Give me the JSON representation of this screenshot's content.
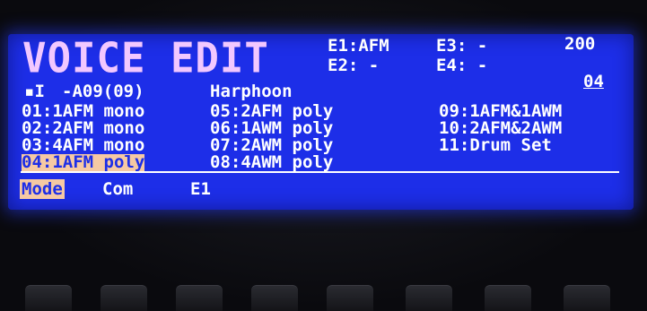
{
  "screen": {
    "title": "VOICE EDIT",
    "element_status": {
      "e1": "E1:AFM",
      "e2": "E2: -",
      "e3": "E3: -",
      "e4": "E4: -"
    },
    "value_top_right": "200",
    "page_number": "04",
    "voice_line": {
      "marker": "▪I",
      "voice_id": "-A09(09)",
      "voice_name": "Harphoon"
    },
    "mode_options": [
      {
        "label": "01:1AFM mono",
        "selected": false
      },
      {
        "label": "02:2AFM mono",
        "selected": false
      },
      {
        "label": "03:4AFM mono",
        "selected": false
      },
      {
        "label": "04:1AFM poly",
        "selected": true
      },
      {
        "label": "05:2AFM poly",
        "selected": false
      },
      {
        "label": "06:1AWM poly",
        "selected": false
      },
      {
        "label": "07:2AWM poly",
        "selected": false
      },
      {
        "label": "08:4AWM poly",
        "selected": false
      },
      {
        "label": "09:1AFM&1AWM",
        "selected": false
      },
      {
        "label": "10:2AFM&2AWM",
        "selected": false
      },
      {
        "label": "11:Drum Set",
        "selected": false
      }
    ],
    "footer_tabs": [
      {
        "label": "Mode",
        "selected": true
      },
      {
        "label": "Com",
        "selected": false
      },
      {
        "label": "E1",
        "selected": false
      }
    ]
  },
  "colors": {
    "lcd_background": "#1d2ee8",
    "text": "#ffffff",
    "highlight": "#f6c9a3",
    "title": "#f2c8ff"
  }
}
